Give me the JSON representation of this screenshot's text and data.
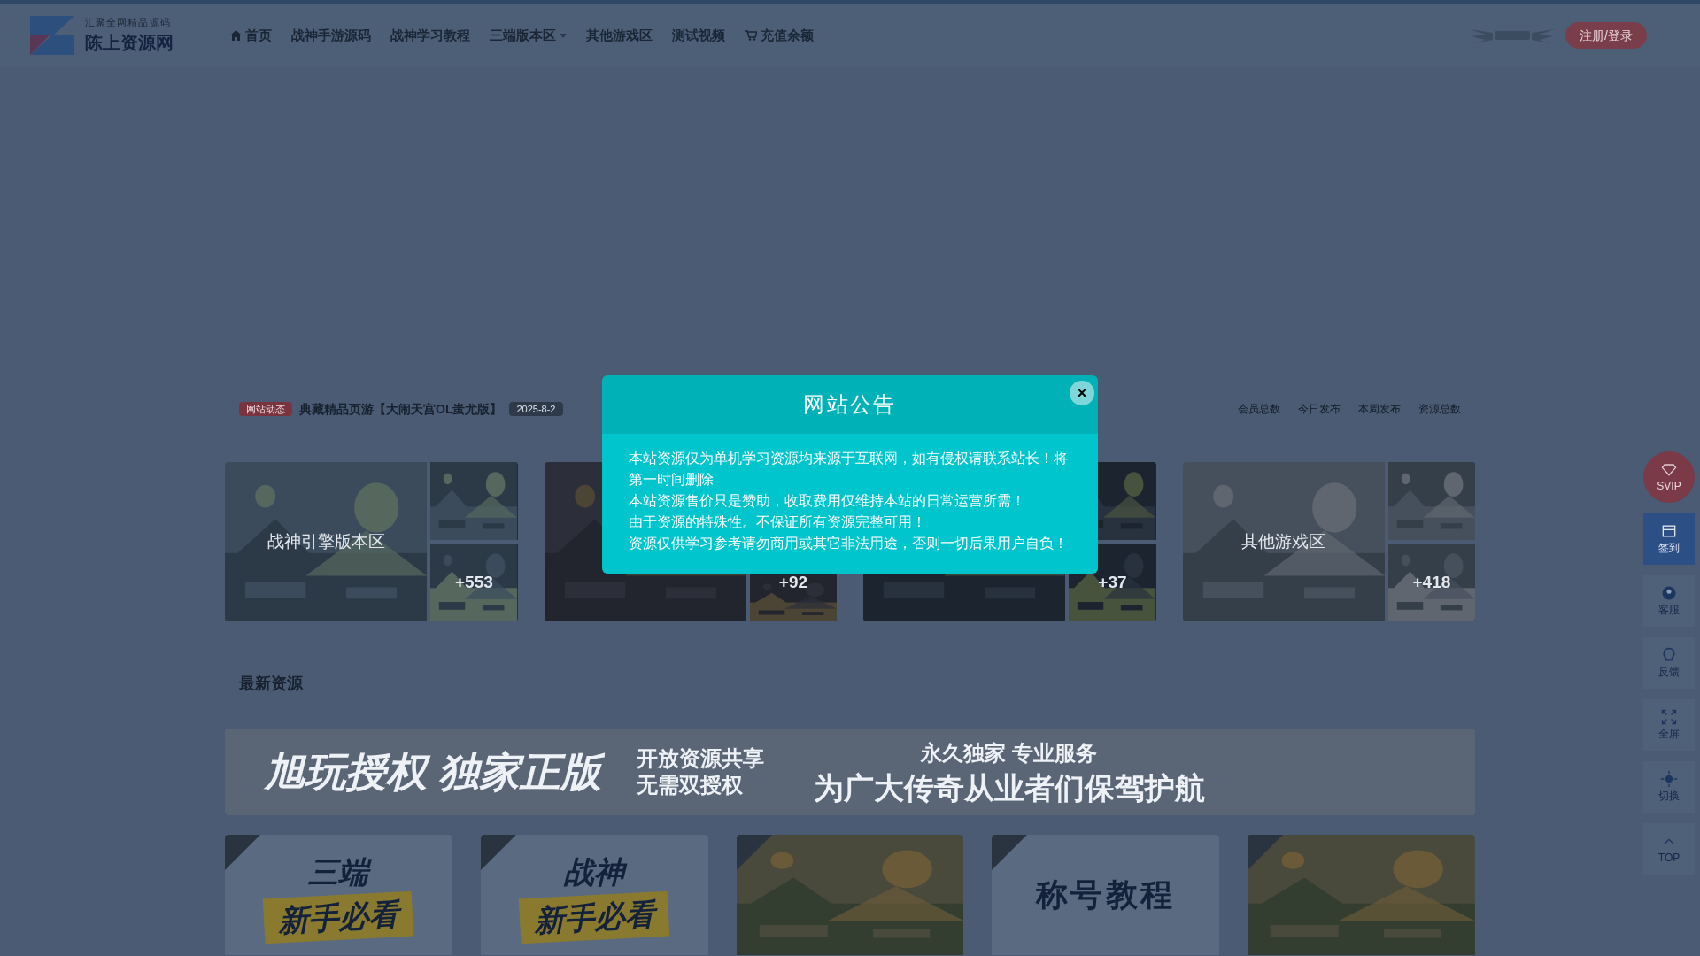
{
  "logo": {
    "tagline": "汇聚全网精品源码",
    "name": "陈上资源网"
  },
  "nav": [
    {
      "label": "首页",
      "kind": "home",
      "has_menu": false
    },
    {
      "label": "战神手游源码",
      "kind": "plain",
      "has_menu": false
    },
    {
      "label": "战神学习教程",
      "kind": "plain",
      "has_menu": false
    },
    {
      "label": "三端版本区",
      "kind": "plain",
      "has_menu": true
    },
    {
      "label": "其他游戏区",
      "kind": "plain",
      "has_menu": false
    },
    {
      "label": "测试视频",
      "kind": "plain",
      "has_menu": false
    },
    {
      "label": "充值余额",
      "kind": "cart",
      "has_menu": false
    }
  ],
  "login_button": "注册/登录",
  "ticker": {
    "badge": "网站动态",
    "headline": "典藏精品页游【大闹天宫OL蚩尤版】",
    "date": "2025-8-2"
  },
  "stats": [
    "会员总数",
    "今日发布",
    "本周发布",
    "资源总数"
  ],
  "categories": [
    {
      "title": "战神引擎版本区",
      "count": "+553"
    },
    {
      "count": "+92"
    },
    {
      "count": "+37"
    },
    {
      "title": "其他游戏区",
      "count": "+418"
    }
  ],
  "section_title": "最新资源",
  "banner": {
    "left": "旭玩授权 独家正版",
    "middle_top": "开放资源共享",
    "middle_bottom": "无需双授权",
    "right_top": "永久独家 专业服务",
    "right_bottom": "为广大传奇从业者们保驾护航"
  },
  "posts": [
    {
      "kind": "text",
      "top": "三端",
      "bottom": "新手必看"
    },
    {
      "kind": "text",
      "top": "战神",
      "bottom": "新手必看"
    },
    {
      "kind": "picture"
    },
    {
      "kind": "title",
      "top": "称号教程"
    },
    {
      "kind": "picture"
    }
  ],
  "side_tools": [
    {
      "label": "SVIP",
      "kind": "svip",
      "selected": false
    },
    {
      "label": "签到",
      "kind": "signin",
      "selected": true
    },
    {
      "label": "客服",
      "kind": "service",
      "selected": false
    },
    {
      "label": "反馈",
      "kind": "feedback",
      "selected": false
    },
    {
      "label": "全屏",
      "kind": "fullscreen",
      "selected": false
    },
    {
      "label": "切换",
      "kind": "theme",
      "selected": false
    },
    {
      "label": "TOP",
      "kind": "top",
      "selected": false
    }
  ],
  "modal": {
    "title": "网站公告",
    "close": "×",
    "lines": [
      "本站资源仅为单机学习资源均来源于互联网，如有侵权请联系站长！将第一时间删除",
      "本站资源售价只是赞助，收取费用仅维持本站的日常运营所需！",
      "由于资源的特殊性。不保证所有资源完整可用！",
      "资源仅供学习参考请勿商用或其它非法用途，否则一切后果用户自负！"
    ]
  }
}
